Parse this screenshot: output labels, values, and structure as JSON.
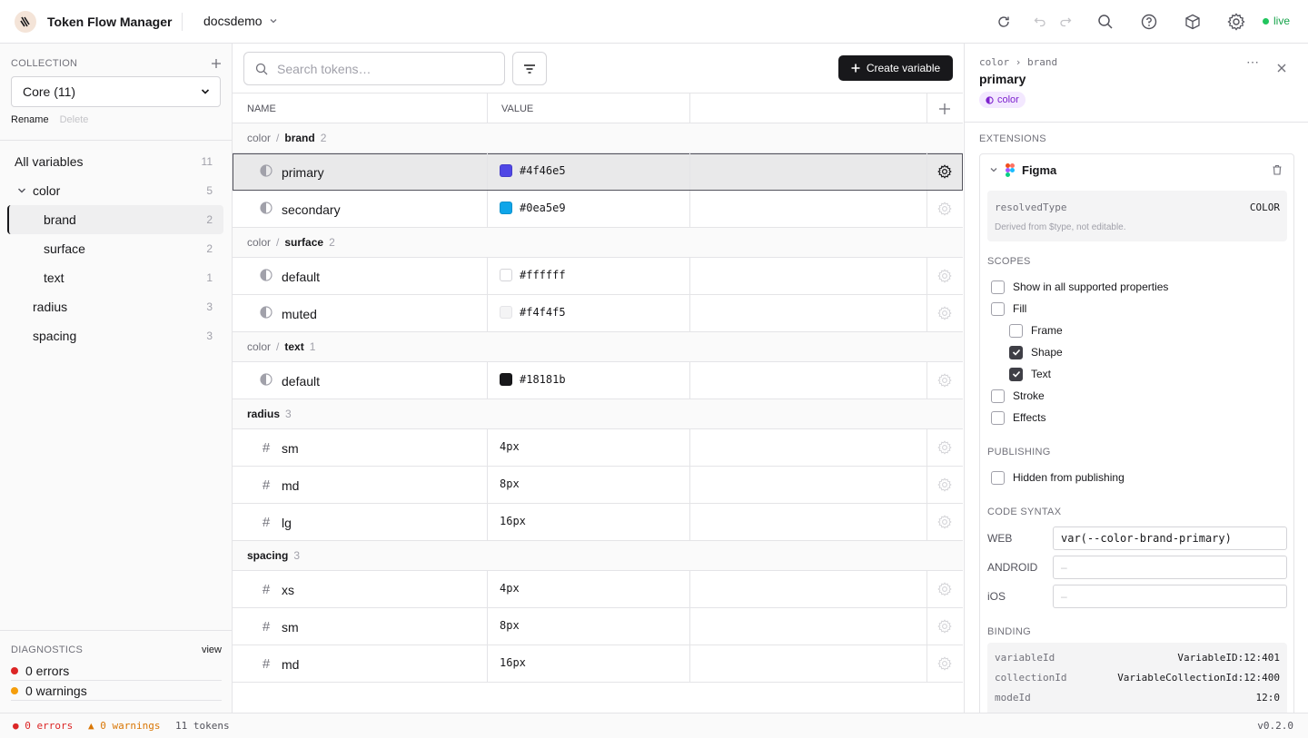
{
  "header": {
    "app_name": "Token Flow Manager",
    "project": "docsdemo",
    "status": "live"
  },
  "sidebar": {
    "collection_label": "COLLECTION",
    "collection_value": "Core (11)",
    "rename": "Rename",
    "delete": "Delete",
    "tree": [
      {
        "label": "All variables",
        "count": "11"
      },
      {
        "label": "color",
        "count": "5"
      },
      {
        "label": "brand",
        "count": "2"
      },
      {
        "label": "surface",
        "count": "2"
      },
      {
        "label": "text",
        "count": "1"
      },
      {
        "label": "radius",
        "count": "3"
      },
      {
        "label": "spacing",
        "count": "3"
      }
    ],
    "diagnostics_label": "DIAGNOSTICS",
    "diagnostics_view": "view",
    "errors": "0 errors",
    "warnings": "0 warnings"
  },
  "toolbar": {
    "search_placeholder": "Search tokens…",
    "create_label": "Create variable"
  },
  "table": {
    "col_name": "NAME",
    "col_value": "VALUE",
    "groups": [
      {
        "parent": "color",
        "name": "brand",
        "count": "2",
        "rows": [
          {
            "name": "primary",
            "value": "#4f46e5",
            "swatch": "#4f46e5"
          },
          {
            "name": "secondary",
            "value": "#0ea5e9",
            "swatch": "#0ea5e9"
          }
        ]
      },
      {
        "parent": "color",
        "name": "surface",
        "count": "2",
        "rows": [
          {
            "name": "default",
            "value": "#ffffff",
            "swatch": "#ffffff"
          },
          {
            "name": "muted",
            "value": "#f4f4f5",
            "swatch": "#f4f4f5"
          }
        ]
      },
      {
        "parent": "color",
        "name": "text",
        "count": "1",
        "rows": [
          {
            "name": "default",
            "value": "#18181b",
            "swatch": "#18181b"
          }
        ]
      },
      {
        "name": "radius",
        "count": "3",
        "rows": [
          {
            "name": "sm",
            "value": "4px"
          },
          {
            "name": "md",
            "value": "8px"
          },
          {
            "name": "lg",
            "value": "16px"
          }
        ]
      },
      {
        "name": "spacing",
        "count": "3",
        "rows": [
          {
            "name": "xs",
            "value": "4px"
          },
          {
            "name": "sm",
            "value": "8px"
          },
          {
            "name": "md",
            "value": "16px"
          }
        ]
      }
    ]
  },
  "panel": {
    "crumb_parent": "color",
    "crumb_sep": "›",
    "crumb_child": "brand",
    "title": "primary",
    "type_pill": "color",
    "extensions_label": "EXTENSIONS",
    "ext_name": "Figma",
    "resolved_key": "resolvedType",
    "resolved_val": "COLOR",
    "resolved_note": "Derived from $type, not editable.",
    "scopes_label": "SCOPES",
    "scopes": [
      {
        "label": "Show in all supported properties",
        "checked": false
      },
      {
        "label": "Fill",
        "checked": false
      },
      {
        "label": "Frame",
        "checked": false
      },
      {
        "label": "Shape",
        "checked": true
      },
      {
        "label": "Text",
        "checked": true
      },
      {
        "label": "Stroke",
        "checked": false
      },
      {
        "label": "Effects",
        "checked": false
      }
    ],
    "publishing_label": "PUBLISHING",
    "hidden_label": "Hidden from publishing",
    "code_label": "CODE SYNTAX",
    "web_label": "WEB",
    "web_value": "var(--color-brand-primary)",
    "android_label": "ANDROID",
    "android_value": "–",
    "ios_label": "iOS",
    "ios_value": "–",
    "binding_label": "BINDING",
    "binding": [
      {
        "k": "variableId",
        "v": "VariableID:12:401"
      },
      {
        "k": "collectionId",
        "v": "VariableCollectionId:12:400"
      },
      {
        "k": "modeId",
        "v": "12:0"
      }
    ]
  },
  "statusbar": {
    "errors": "● 0 errors",
    "warnings": "▲ 0 warnings",
    "tokens": "11 tokens",
    "version": "v0.2.0"
  },
  "colors": {
    "accent": "#18181b",
    "brand_primary": "#4f46e5",
    "error": "#dc2626",
    "warning": "#f59e0b",
    "live": "#22c55e"
  }
}
